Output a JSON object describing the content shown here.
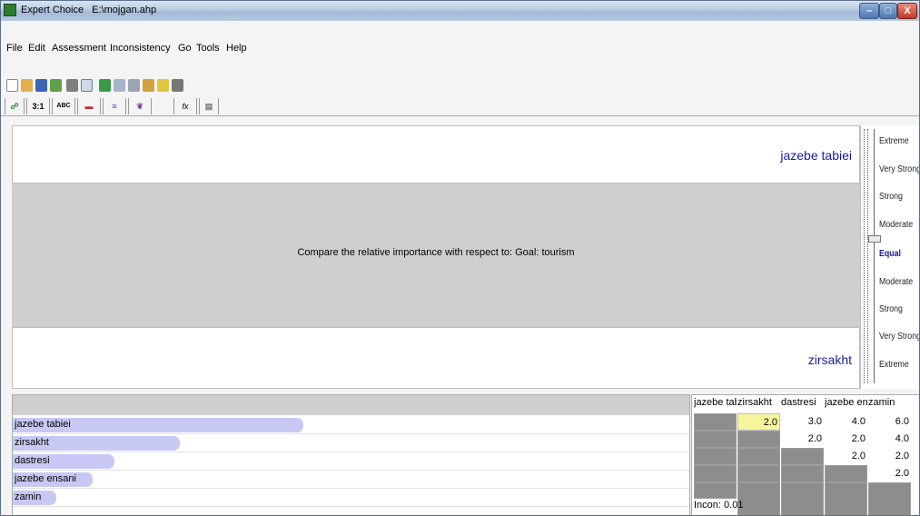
{
  "window": {
    "app_name": "Expert Choice",
    "file_path": "E:\\mojgan.ahp",
    "min_label": "–",
    "max_label": "□",
    "close_label": "X"
  },
  "menu": [
    "File",
    "Edit",
    "Assessment",
    "Inconsistency",
    "Go",
    "Tools",
    "Help"
  ],
  "toolbar2": {
    "tab_31": "3:1",
    "tab_abc": "ABC",
    "tab_fx": "fx"
  },
  "comparison": {
    "top_item": "jazebe tabiei",
    "bottom_item": "zirsakht",
    "prompt": "Compare the relative importance with respect to: Goal: tourism"
  },
  "scale": {
    "labels": [
      "Extreme",
      "Very Strong",
      "Strong",
      "Moderate",
      "Equal",
      "Moderate",
      "Strong",
      "Very Strong",
      "Extreme"
    ],
    "selected": "Equal"
  },
  "priorities": {
    "items": [
      {
        "name": "jazebe tabiei",
        "weight": 0.4
      },
      {
        "name": "zirsakht",
        "weight": 0.23
      },
      {
        "name": "dastresi",
        "weight": 0.14
      },
      {
        "name": "jazebe ensani",
        "weight": 0.11
      },
      {
        "name": "zamin",
        "weight": 0.06
      }
    ]
  },
  "matrix": {
    "headers": [
      "jazebe tabi",
      "zirsakht",
      "dastresi",
      "jazebe ens",
      "zamin"
    ],
    "rows": [
      [
        "",
        "2.0",
        "3.0",
        "4.0",
        "6.0"
      ],
      [
        "",
        "",
        "2.0",
        "2.0",
        "4.0"
      ],
      [
        "",
        "",
        "",
        "2.0",
        "2.0"
      ],
      [
        "",
        "",
        "",
        "",
        "2.0"
      ]
    ],
    "incon": "Incon: 0.01"
  },
  "colors": {
    "bar": "#c8c8f4",
    "selected_cell": "#f6f59c",
    "gray_cell": "#8d8d8d",
    "item_label": "#1a1aa0"
  }
}
